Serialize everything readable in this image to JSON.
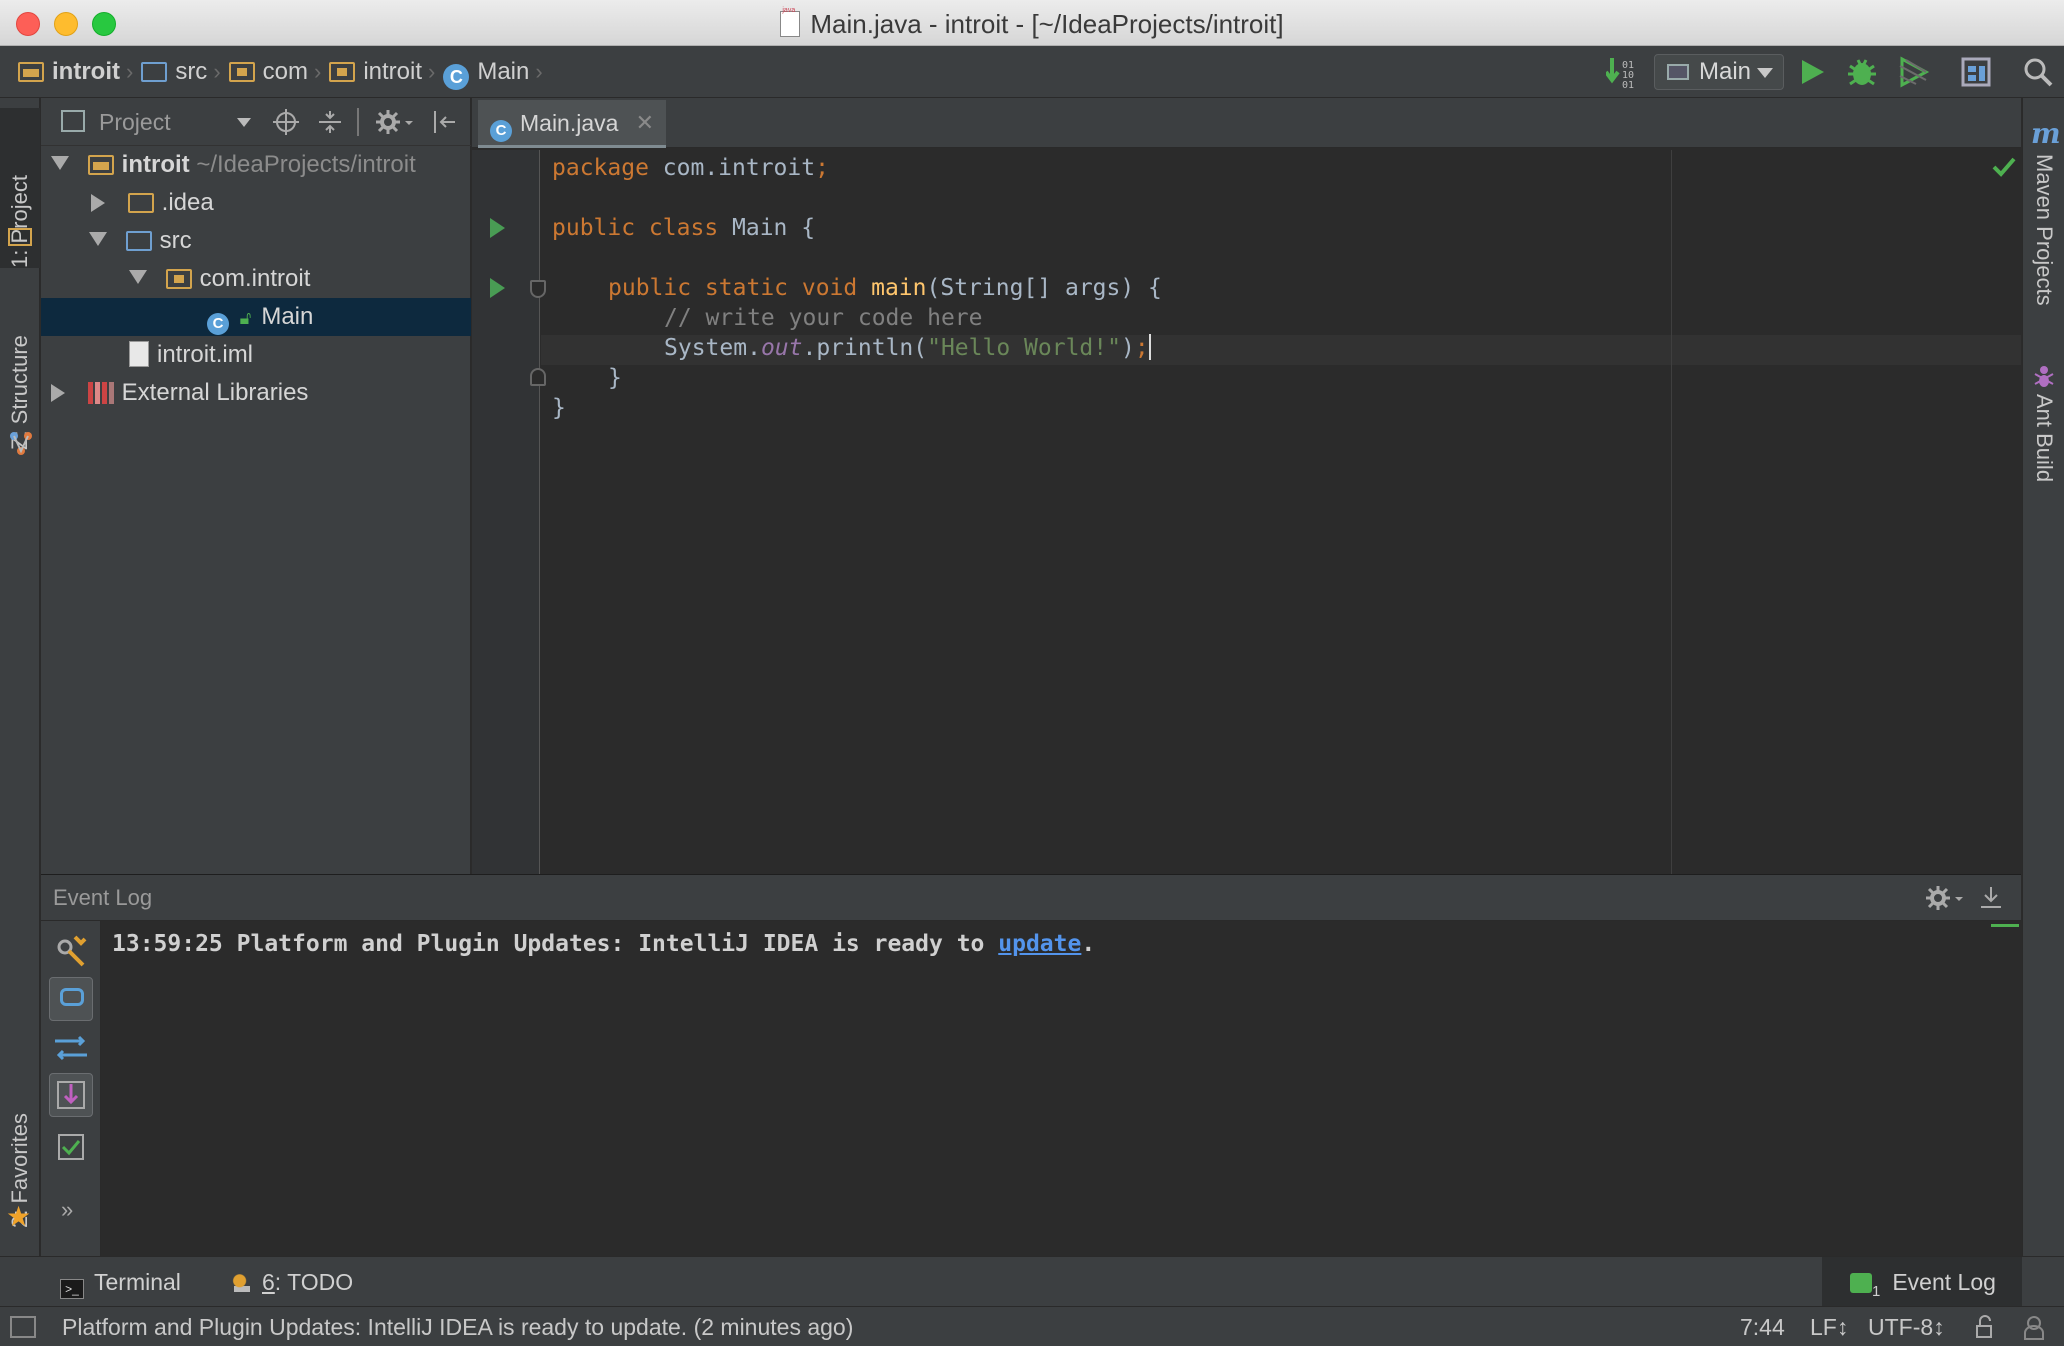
{
  "window": {
    "title": "Main.java - introit - [~/IdeaProjects/introit]"
  },
  "navbar": {
    "crumbs": [
      "introit",
      "src",
      "com",
      "introit",
      "Main"
    ],
    "run_config": "Main"
  },
  "left_strip": {
    "project_tab": "1: Project",
    "structure_tab": "Z: Structure",
    "favorites_tab": "2: Favorites"
  },
  "right_strip": {
    "maven_tab": "Maven Projects",
    "ant_tab": "Ant Build"
  },
  "project_panel": {
    "header": "Project",
    "tree": {
      "root_name": "introit",
      "root_path": "~/IdeaProjects/introit",
      "idea": ".idea",
      "src": "src",
      "package": "com.introit",
      "main_class": "Main",
      "iml": "introit.iml",
      "libs": "External Libraries"
    }
  },
  "editor": {
    "tab_label": "Main.java",
    "code": {
      "l1_kw": "package",
      "l1_rest": " com.introit",
      "l1_semi": ";",
      "l3_kw": "public class ",
      "l3_rest": "Main {",
      "l5_kw": "public static void ",
      "l5_fn": "main",
      "l5_rest": "(String[] args) {",
      "l6": "// write your code here",
      "l7_a": "System.",
      "l7_b": "out",
      "l7_c": ".println(",
      "l7_str": "\"Hello World!\"",
      "l7_d": ")",
      "l7_semi": ";",
      "l8": "}",
      "l9": "}"
    }
  },
  "event_log": {
    "header": "Event Log",
    "entry_time": "13:59:25",
    "entry_text": "Platform and Plugin Updates: IntelliJ IDEA is ready to ",
    "entry_link": "update",
    "entry_end": "."
  },
  "bottom_bar": {
    "terminal": "Terminal",
    "todo_num": "6",
    "todo": ": TODO",
    "event_log": "Event Log",
    "event_log_count": "1"
  },
  "status_bar": {
    "message": "Platform and Plugin Updates: IntelliJ IDEA is ready to update. (2 minutes ago)",
    "position": "7:44",
    "line_sep": "LF↕",
    "encoding": "UTF-8↕"
  },
  "colors": {
    "background": "#2b2b2b",
    "panel": "#3c3f41",
    "keyword": "#cc7832",
    "string": "#6a8759",
    "function": "#ffc66d",
    "link": "#5394ec",
    "selection": "#0d293e"
  }
}
